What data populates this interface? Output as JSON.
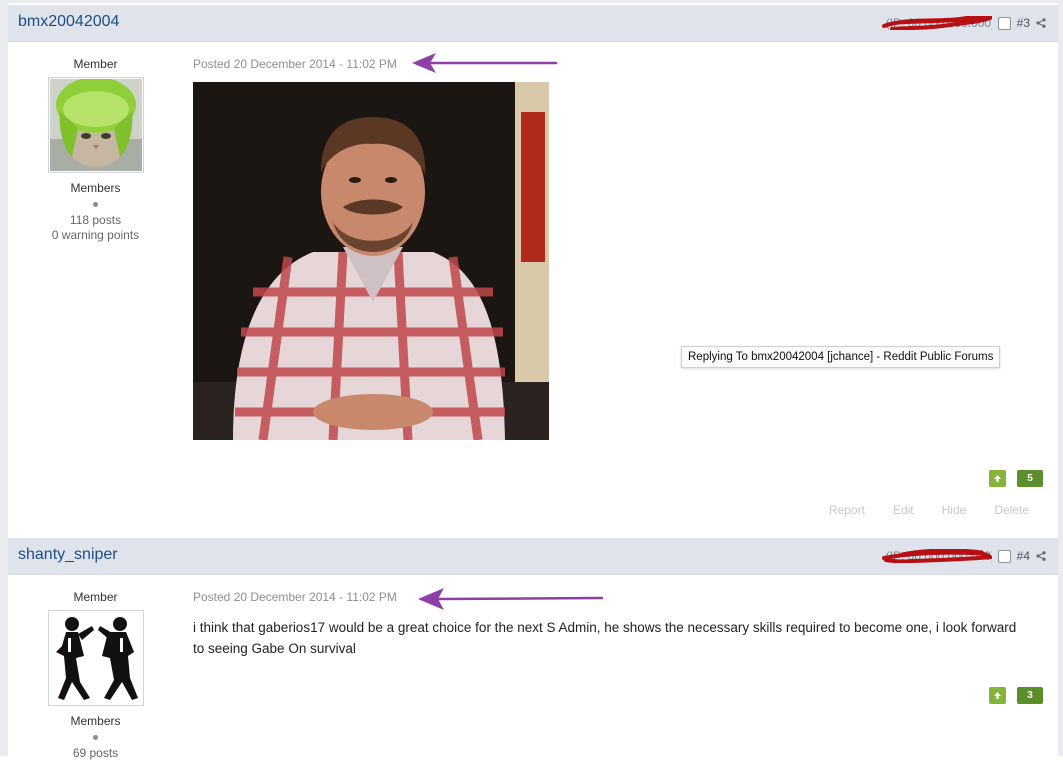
{
  "posts": [
    {
      "username": "bmx20042004",
      "ip_visible": "(IP: 00.000.000.000)",
      "post_number": "#3",
      "author_title": "Member",
      "group": "Members",
      "posts_count": "118 posts",
      "warning_points": "0 warning points",
      "posted": "Posted 20 December 2014 - 11:02 PM",
      "reputation": "5",
      "controls": [
        "Report",
        "Edit",
        "Hide",
        "Delete"
      ],
      "tooltip": "Replying To bmx20042004 [jchance] - Reddit Public Forums"
    },
    {
      "username": "shanty_sniper",
      "ip_visible": "(IP: 00.000.000.000)",
      "post_number": "#4",
      "author_title": "Member",
      "group": "Members",
      "posts_count": "69 posts",
      "posted": "Posted 20 December 2014 - 11:02 PM",
      "body": "i think that gaberios17 would be a great choice for the next S Admin, he shows the necessary skills required to become one, i look forward to seeing Gabe On survival",
      "reputation": "3"
    }
  ],
  "colors": {
    "header_bg": "#dfe3ec",
    "username": "#1f4f82",
    "rep_green": "#5c8f2b",
    "annotation_arrow": "#8e3fa6",
    "redaction_scribble": "#b80f12"
  },
  "icons": [
    "share-icon",
    "checkbox",
    "thumbs-up-arrow-icon",
    "annotation-arrow",
    "redaction-scribble"
  ]
}
